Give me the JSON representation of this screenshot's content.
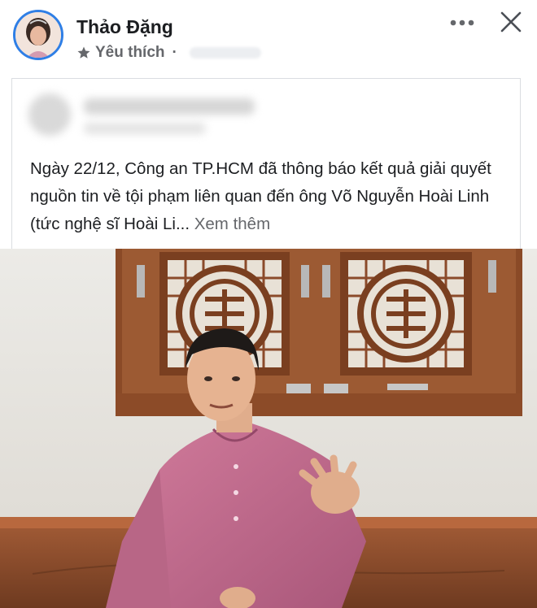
{
  "post": {
    "author": "Thảo Đặng",
    "status_label": "Yêu thích",
    "separator": "·"
  },
  "shared": {
    "text": "Ngày 22/12, Công an TP.HCM đã thông báo kết quả giải quyết nguồn tin về tội phạm liên quan đến ông Võ Nguyễn Hoài Linh (tức nghệ sĩ Hoài Li...",
    "see_more": "Xem thêm"
  },
  "icons": {
    "avatar": "avatar-photo",
    "status": "star-icon",
    "more": "more-horizontal-icon",
    "close": "close-icon"
  },
  "colors": {
    "avatar_ring": "#2f7fe6",
    "text": "#1c1e21",
    "secondary_text": "#65676b",
    "divider": "#dadde1"
  }
}
